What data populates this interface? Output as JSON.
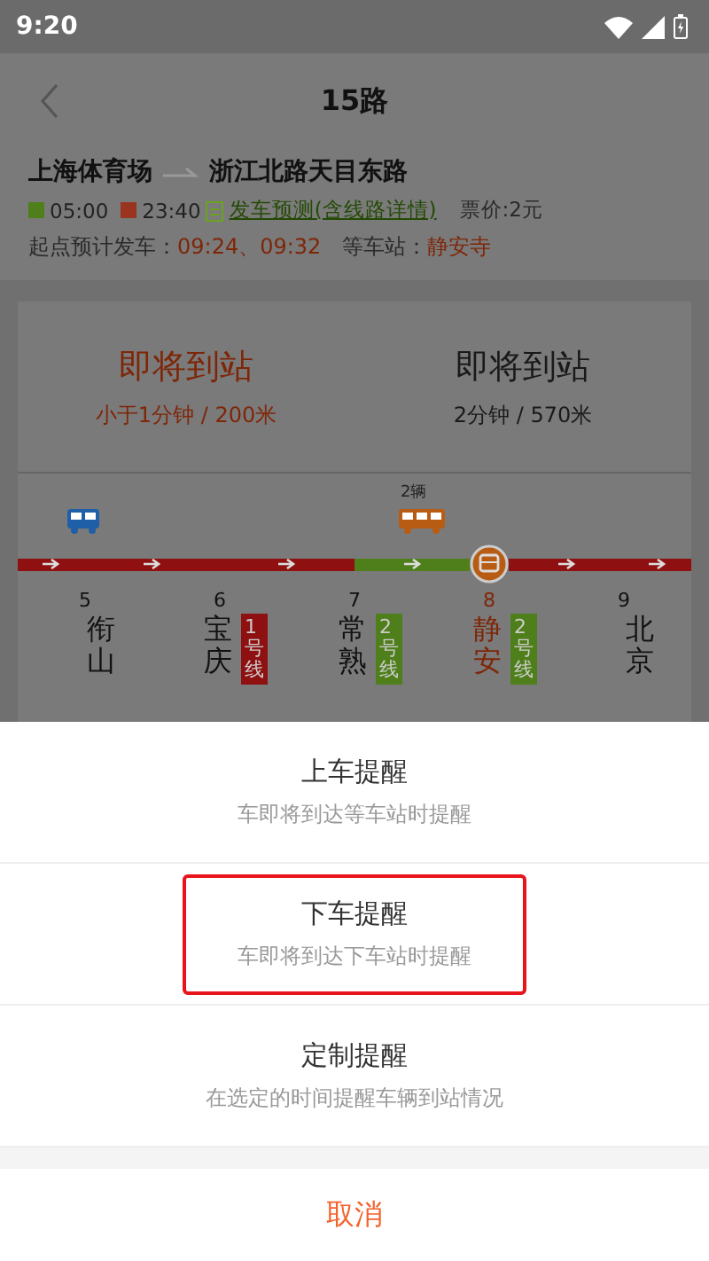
{
  "status_bar": {
    "time": "9:20"
  },
  "header": {
    "title": "15路"
  },
  "route": {
    "from": "上海体育场",
    "to": "浙江北路天目东路",
    "first_bus": "05:00",
    "last_bus": "23:40",
    "prediction_link": "发车预测(含线路详情)",
    "fare": "票价:2元"
  },
  "departure": {
    "label": "起点预计发车：",
    "times": "09:24、09:32",
    "stop_label": "等车站：",
    "stop": "静安寺"
  },
  "arrivals": [
    {
      "status": "即将到站",
      "detail": "小于1分钟 / 200米",
      "selected": true
    },
    {
      "status": "即将到站",
      "detail": "2分钟 / 570米",
      "selected": false
    }
  ],
  "stations": [
    {
      "number": "5",
      "name": "衔山",
      "current": false,
      "bus": {
        "color": "#1f5fa8"
      }
    },
    {
      "number": "6",
      "name": "宝庆",
      "current": false,
      "line": {
        "label": "1号线",
        "color": "#8e1010"
      }
    },
    {
      "number": "7",
      "name": "常熟",
      "current": false,
      "line": {
        "label": "2号线",
        "color": "#4f7f1a"
      }
    },
    {
      "number": "8",
      "name": "静安",
      "current": true,
      "line": {
        "label": "2号线",
        "color": "#4f7f1a"
      }
    },
    {
      "number": "9",
      "name": "北京",
      "current": false
    }
  ],
  "segments": [
    {
      "color": "#8e1010"
    },
    {
      "color": "#8e1010"
    },
    {
      "color": "#8e1010"
    },
    {
      "color": "#4f7f1a",
      "bus": {
        "color": "#b85c14",
        "count": "2辆"
      }
    },
    {
      "color": "#8e1010"
    },
    {
      "color": "#8e1010"
    }
  ],
  "sheet": {
    "options": [
      {
        "title": "上车提醒",
        "subtitle": "车即将到达等车站时提醒",
        "highlighted": false
      },
      {
        "title": "下车提醒",
        "subtitle": "车即将到达下车站时提醒",
        "highlighted": true
      },
      {
        "title": "定制提醒",
        "subtitle": "在选定的时间提醒车辆到站情况",
        "highlighted": false
      }
    ],
    "cancel": "取消"
  }
}
